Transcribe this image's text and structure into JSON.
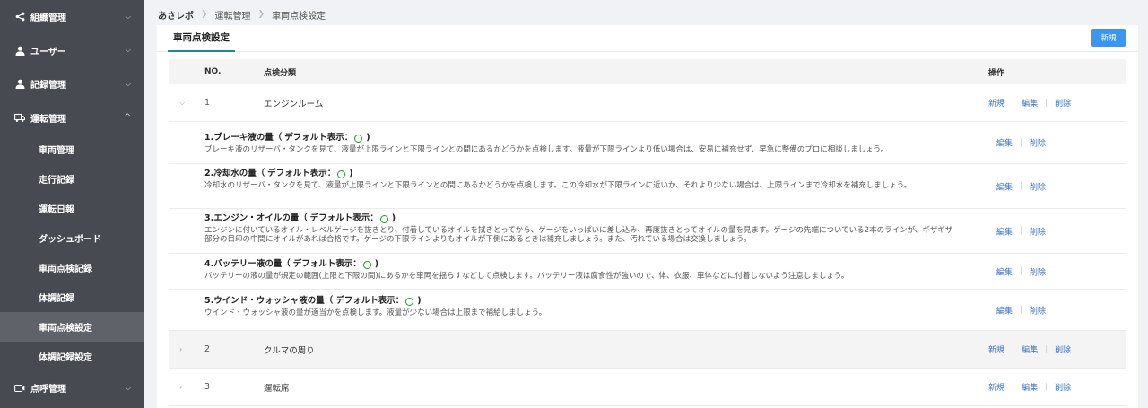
{
  "sidebar": {
    "groups": [
      {
        "label": "組織管理",
        "icon": "share-icon",
        "expanded": false
      },
      {
        "label": "ユーザー",
        "icon": "user-icon",
        "expanded": false
      },
      {
        "label": "記録管理",
        "icon": "user-icon",
        "expanded": false
      },
      {
        "label": "運転管理",
        "icon": "truck-icon",
        "expanded": true
      },
      {
        "label": "点呼管理",
        "icon": "camera-icon",
        "expanded": false
      }
    ],
    "sub_items": [
      "車両管理",
      "走行記録",
      "運転日報",
      "ダッシュボード",
      "車両点検記録",
      "体調記録",
      "車両点検設定",
      "体調記録設定"
    ],
    "active_sub": "車両点検設定"
  },
  "breadcrumb": [
    "あさレポ",
    "運転管理",
    "車両点検設定"
  ],
  "panel": {
    "tab_label": "車両点検設定",
    "new_button": "新規"
  },
  "table": {
    "headers": {
      "no": "NO.",
      "category": "点検分類",
      "ops": "操作"
    },
    "op_labels": {
      "new": "新規",
      "edit": "編集",
      "delete": "削除"
    },
    "default_text": "デフォルト表示：",
    "categories": [
      {
        "no": "1",
        "name": "エンジンルーム",
        "expanded": true
      },
      {
        "no": "2",
        "name": "クルマの周り",
        "expanded": false
      },
      {
        "no": "3",
        "name": "運転席",
        "expanded": false
      }
    ],
    "items": [
      {
        "title": "1.ブレーキ液の量（",
        "desc": "ブレーキ液のリザーバ・タンクを見て、液量が上限ラインと下限ラインとの間にあるかどうかを点検します。液量が下限ラインより低い場合は、安易に補充せず、早急に整備のプロに相談しましょう。"
      },
      {
        "title": "2.冷却水の量（",
        "desc": "冷却水のリザーバ・タンクを見て、液量が上限ラインと下限ラインとの間にあるかどうかを点検します。この冷却水が下限ラインに近いか、それより少ない場合は、上限ラインまで冷却水を補充しましょう。"
      },
      {
        "title": "3.エンジン・オイルの量（",
        "desc": "エンジンに付いているオイル・レベルゲージを抜きとり、付着しているオイルを拭きとってから、ゲージをいっぱいに差し込み、再度抜きとってオイルの量を見ます。ゲージの先端についている2本のラインが、ギザギザ部分の目印の中間にオイルがあれば合格です。ゲージの下限ラインよりもオイルが下側にあるときは補充しましょう。また、汚れている場合は交換しましょう。"
      },
      {
        "title": "4.バッテリー液の量（",
        "desc": "バッテリーの液の量が規定の範囲(上限と下限の間)にあるかを車両を揺らすなどして点検します。バッテリー液は腐食性が強いので、体、衣服、車体などに付着しないよう注意しましょう。"
      },
      {
        "title": "5.ウインド・ウォッシャ液の量（",
        "desc": "ウインド・ウォッシャ液の量が適当かを点検します。液量が少ない場合は上限まで補給しましょう。"
      }
    ]
  }
}
